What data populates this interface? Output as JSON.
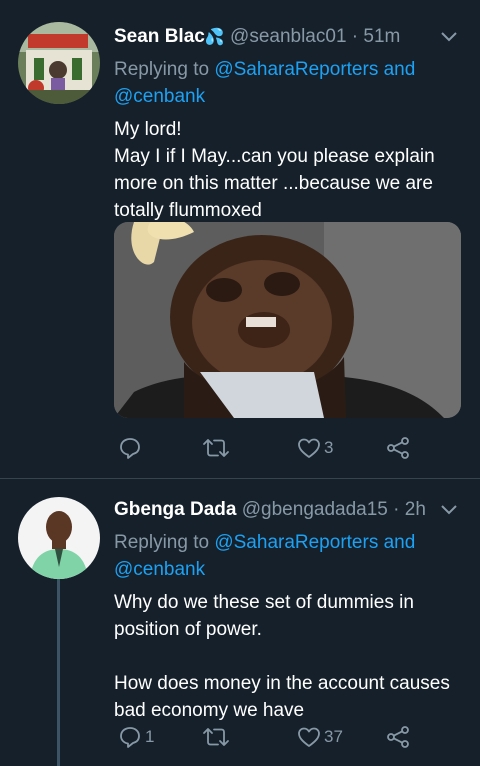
{
  "tweets": [
    {
      "name": "Sean Blac",
      "name_emoji": "💦",
      "handle": "@seanblac01",
      "time": "· 51m",
      "replying_prefix": "Replying to ",
      "replying_link1": "@SaharaReporters and",
      "replying_link2": "@cenbank",
      "text": "My lord!\nMay I if I May...can you please explain more on this matter ...because we are totally flummoxed",
      "likes": "3",
      "replies": "",
      "retweets": ""
    },
    {
      "name": "Gbenga Dada",
      "handle": "@gbengadada15",
      "time": "· 2h",
      "replying_prefix": "Replying to ",
      "replying_link1": "@SaharaReporters and",
      "replying_link2": "@cenbank",
      "text": "Why do we these set of dummies in position of power.\n\nHow does money in the account causes bad economy we have",
      "replies": "1",
      "retweets": "",
      "likes": "37"
    }
  ],
  "colors": {
    "background": "#15202b",
    "secondary_text": "#8899a6",
    "link": "#1da1f2",
    "divider": "#38444d"
  },
  "icons": [
    "chevron-down-icon",
    "reply-icon",
    "retweet-icon",
    "like-icon",
    "share-icon"
  ]
}
